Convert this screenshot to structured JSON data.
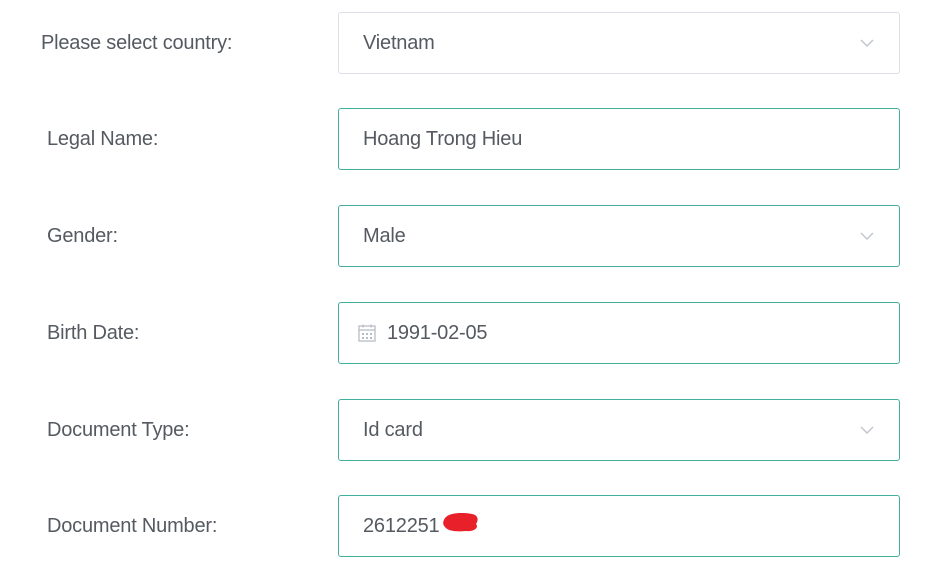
{
  "form": {
    "country": {
      "label": "Please select country:",
      "value": "Vietnam",
      "icon": "chevron-down-icon"
    },
    "legal_name": {
      "label": "Legal Name:",
      "value": "Hoang Trong Hieu"
    },
    "gender": {
      "label": "Gender:",
      "value": "Male",
      "icon": "chevron-down-icon"
    },
    "birth_date": {
      "label": "Birth Date:",
      "value": "1991-02-05",
      "icon": "calendar-icon"
    },
    "document_type": {
      "label": "Document Type:",
      "value": "Id card",
      "icon": "chevron-down-icon"
    },
    "document_number": {
      "label": "Document Number:",
      "value": "2612251"
    }
  },
  "colors": {
    "active_border": "#41ad9c",
    "default_border": "#dcdfe6",
    "text": "#555a60",
    "redaction": "#e8202a"
  }
}
